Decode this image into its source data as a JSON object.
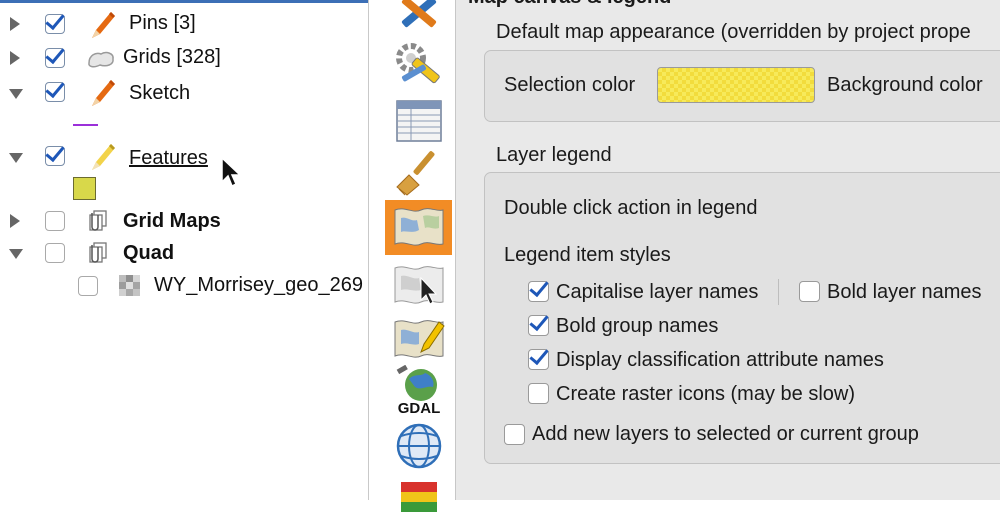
{
  "layer_tree": {
    "items": [
      {
        "label": "Pins [3]",
        "checked": true,
        "expanded": false,
        "icon": "pencil-icon"
      },
      {
        "label": "Grids [328]",
        "checked": true,
        "expanded": false,
        "icon": "polygon-icon"
      },
      {
        "label": "Sketch",
        "checked": true,
        "expanded": true,
        "icon": "pencil-icon"
      },
      {
        "label": "Features",
        "checked": true,
        "expanded": true,
        "icon": "pencil-icon"
      },
      {
        "label": "Grid Maps",
        "checked": false,
        "expanded": false,
        "icon": "group-icon"
      },
      {
        "label": "Quad",
        "checked": false,
        "expanded": true,
        "icon": "group-icon"
      },
      {
        "label": "WY_Morrisey_geo_269",
        "checked": false,
        "icon": "raster-icon"
      }
    ]
  },
  "categories": [
    {
      "name": "general-settings-icon"
    },
    {
      "name": "system-settings-icon"
    },
    {
      "name": "data-sources-icon"
    },
    {
      "name": "rendering-icon"
    },
    {
      "name": "canvas-legend-icon",
      "selected": true
    },
    {
      "name": "map-tools-icon"
    },
    {
      "name": "digitizing-icon"
    },
    {
      "name": "gdal-icon",
      "text": "GDAL"
    },
    {
      "name": "crs-icon"
    },
    {
      "name": "locale-icon"
    }
  ],
  "panel": {
    "section_title": "Map canvas & legend",
    "map_appearance": {
      "title": "Default map appearance (overridden by project prope",
      "selection_color_label": "Selection color",
      "selection_color": "#f5e14a",
      "background_color_label": "Background color"
    },
    "layer_legend": {
      "title": "Layer legend",
      "double_click_label": "Double click action in legend",
      "styles_label": "Legend item styles",
      "options": [
        {
          "label": "Capitalise layer names",
          "checked": true
        },
        {
          "label": "Bold layer names",
          "checked": false
        },
        {
          "label": "Bold group names",
          "checked": true
        },
        {
          "label": "Display classification attribute names",
          "checked": true
        },
        {
          "label": "Create raster icons (may be slow)",
          "checked": false
        },
        {
          "label": "Add new layers to selected or current group",
          "checked": false
        }
      ]
    }
  },
  "colors": {
    "accent": "#f28c25",
    "check": "#1e57b8",
    "sketch_line": "#9b30d9",
    "feature_swatch": "#d8d84a"
  }
}
